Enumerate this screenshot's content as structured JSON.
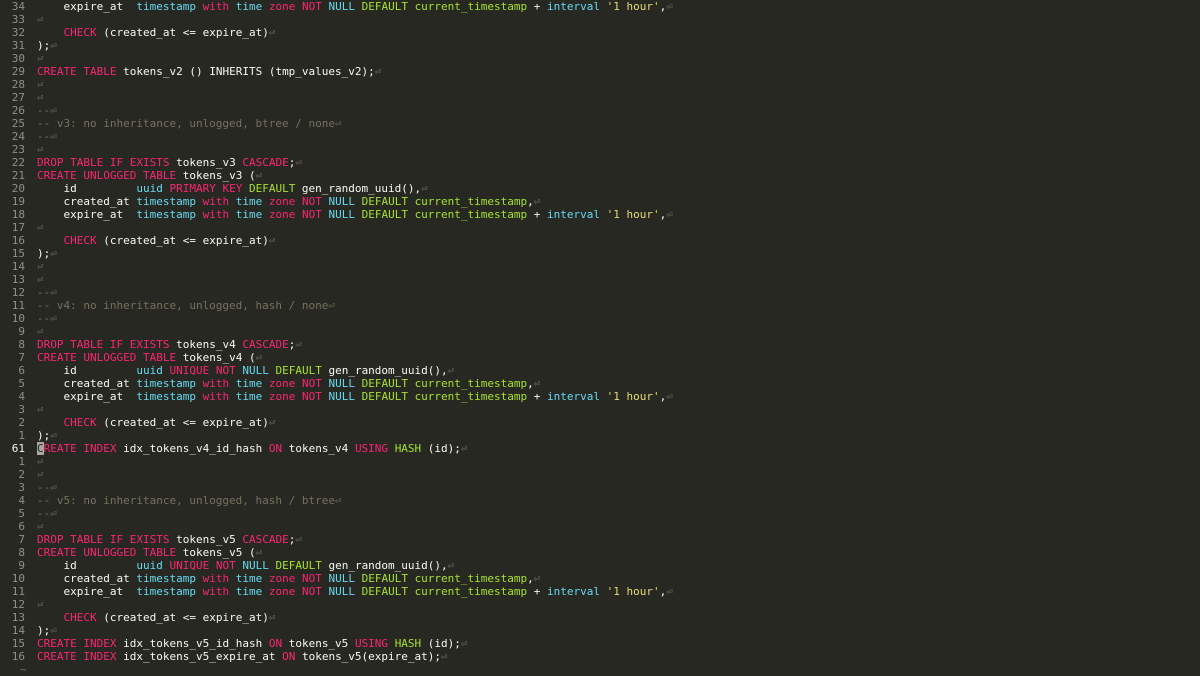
{
  "colors": {
    "background": "#272822",
    "keyword": "#f92672",
    "type": "#66d9ef",
    "string": "#e6db74",
    "comment": "#75715e",
    "function": "#a6e22e",
    "text": "#f8f8f2",
    "line_number": "#8f908a"
  },
  "eol_marker": "⏎",
  "tilde": "~",
  "lines": [
    {
      "num": "34",
      "tokens": [
        [
          "p",
          "    expire_at  "
        ],
        [
          "t",
          "timestamp"
        ],
        [
          "p",
          " "
        ],
        [
          "k",
          "with"
        ],
        [
          "p",
          " "
        ],
        [
          "t",
          "time"
        ],
        [
          "p",
          " "
        ],
        [
          "k",
          "zone"
        ],
        [
          "p",
          " "
        ],
        [
          "k",
          "NOT"
        ],
        [
          "p",
          " "
        ],
        [
          "t",
          "NULL"
        ],
        [
          "p",
          " "
        ],
        [
          "f",
          "DEFAULT"
        ],
        [
          "p",
          " "
        ],
        [
          "f",
          "current_timestamp"
        ],
        [
          "p",
          " + "
        ],
        [
          "t",
          "interval"
        ],
        [
          "p",
          " "
        ],
        [
          "s",
          "'1 hour'"
        ],
        [
          "p",
          ","
        ]
      ]
    },
    {
      "num": "33",
      "tokens": []
    },
    {
      "num": "32",
      "tokens": [
        [
          "p",
          "    "
        ],
        [
          "k",
          "CHECK"
        ],
        [
          "p",
          " (created_at <= expire_at)"
        ]
      ]
    },
    {
      "num": "31",
      "tokens": [
        [
          "p",
          ");"
        ]
      ]
    },
    {
      "num": "30",
      "tokens": []
    },
    {
      "num": "29",
      "tokens": [
        [
          "k",
          "CREATE"
        ],
        [
          "p",
          " "
        ],
        [
          "k",
          "TABLE"
        ],
        [
          "p",
          " tokens_v2 () INHERITS (tmp_values_v2);"
        ]
      ]
    },
    {
      "num": "28",
      "tokens": []
    },
    {
      "num": "27",
      "tokens": []
    },
    {
      "num": "26",
      "tokens": [
        [
          "c",
          "--"
        ]
      ]
    },
    {
      "num": "25",
      "tokens": [
        [
          "c",
          "-- v3: no inheritance, unlogged, btree / none"
        ]
      ]
    },
    {
      "num": "24",
      "tokens": [
        [
          "c",
          "--"
        ]
      ]
    },
    {
      "num": "23",
      "tokens": []
    },
    {
      "num": "22",
      "tokens": [
        [
          "k",
          "DROP"
        ],
        [
          "p",
          " "
        ],
        [
          "k",
          "TABLE"
        ],
        [
          "p",
          " "
        ],
        [
          "k",
          "IF"
        ],
        [
          "p",
          " "
        ],
        [
          "k",
          "EXISTS"
        ],
        [
          "p",
          " tokens_v3 "
        ],
        [
          "k",
          "CASCADE"
        ],
        [
          "p",
          ";"
        ]
      ]
    },
    {
      "num": "21",
      "tokens": [
        [
          "k",
          "CREATE"
        ],
        [
          "p",
          " "
        ],
        [
          "k",
          "UNLOGGED"
        ],
        [
          "p",
          " "
        ],
        [
          "k",
          "TABLE"
        ],
        [
          "p",
          " tokens_v3 ("
        ]
      ]
    },
    {
      "num": "20",
      "tokens": [
        [
          "p",
          "    id         "
        ],
        [
          "t",
          "uuid"
        ],
        [
          "p",
          " "
        ],
        [
          "k",
          "PRIMARY KEY"
        ],
        [
          "p",
          " "
        ],
        [
          "f",
          "DEFAULT"
        ],
        [
          "p",
          " gen_random_uuid(),"
        ]
      ]
    },
    {
      "num": "19",
      "tokens": [
        [
          "p",
          "    created_at "
        ],
        [
          "t",
          "timestamp"
        ],
        [
          "p",
          " "
        ],
        [
          "k",
          "with"
        ],
        [
          "p",
          " "
        ],
        [
          "t",
          "time"
        ],
        [
          "p",
          " "
        ],
        [
          "k",
          "zone"
        ],
        [
          "p",
          " "
        ],
        [
          "k",
          "NOT"
        ],
        [
          "p",
          " "
        ],
        [
          "t",
          "NULL"
        ],
        [
          "p",
          " "
        ],
        [
          "f",
          "DEFAULT"
        ],
        [
          "p",
          " "
        ],
        [
          "f",
          "current_timestamp"
        ],
        [
          "p",
          ","
        ]
      ]
    },
    {
      "num": "18",
      "tokens": [
        [
          "p",
          "    expire_at  "
        ],
        [
          "t",
          "timestamp"
        ],
        [
          "p",
          " "
        ],
        [
          "k",
          "with"
        ],
        [
          "p",
          " "
        ],
        [
          "t",
          "time"
        ],
        [
          "p",
          " "
        ],
        [
          "k",
          "zone"
        ],
        [
          "p",
          " "
        ],
        [
          "k",
          "NOT"
        ],
        [
          "p",
          " "
        ],
        [
          "t",
          "NULL"
        ],
        [
          "p",
          " "
        ],
        [
          "f",
          "DEFAULT"
        ],
        [
          "p",
          " "
        ],
        [
          "f",
          "current_timestamp"
        ],
        [
          "p",
          " + "
        ],
        [
          "t",
          "interval"
        ],
        [
          "p",
          " "
        ],
        [
          "s",
          "'1 hour'"
        ],
        [
          "p",
          ","
        ]
      ]
    },
    {
      "num": "17",
      "tokens": []
    },
    {
      "num": "16",
      "tokens": [
        [
          "p",
          "    "
        ],
        [
          "k",
          "CHECK"
        ],
        [
          "p",
          " (created_at <= expire_at)"
        ]
      ]
    },
    {
      "num": "15",
      "tokens": [
        [
          "p",
          ");"
        ]
      ]
    },
    {
      "num": "14",
      "tokens": []
    },
    {
      "num": "13",
      "tokens": []
    },
    {
      "num": "12",
      "tokens": [
        [
          "c",
          "--"
        ]
      ]
    },
    {
      "num": "11",
      "tokens": [
        [
          "c",
          "-- v4: no inheritance, unlogged, hash / none"
        ]
      ]
    },
    {
      "num": "10",
      "tokens": [
        [
          "c",
          "--"
        ]
      ]
    },
    {
      "num": "9",
      "tokens": []
    },
    {
      "num": "8",
      "tokens": [
        [
          "k",
          "DROP"
        ],
        [
          "p",
          " "
        ],
        [
          "k",
          "TABLE"
        ],
        [
          "p",
          " "
        ],
        [
          "k",
          "IF"
        ],
        [
          "p",
          " "
        ],
        [
          "k",
          "EXISTS"
        ],
        [
          "p",
          " tokens_v4 "
        ],
        [
          "k",
          "CASCADE"
        ],
        [
          "p",
          ";"
        ]
      ]
    },
    {
      "num": "7",
      "tokens": [
        [
          "k",
          "CREATE"
        ],
        [
          "p",
          " "
        ],
        [
          "k",
          "UNLOGGED"
        ],
        [
          "p",
          " "
        ],
        [
          "k",
          "TABLE"
        ],
        [
          "p",
          " tokens_v4 ("
        ]
      ]
    },
    {
      "num": "6",
      "tokens": [
        [
          "p",
          "    id         "
        ],
        [
          "t",
          "uuid"
        ],
        [
          "p",
          " "
        ],
        [
          "k",
          "UNIQUE"
        ],
        [
          "p",
          " "
        ],
        [
          "k",
          "NOT"
        ],
        [
          "p",
          " "
        ],
        [
          "t",
          "NULL"
        ],
        [
          "p",
          " "
        ],
        [
          "f",
          "DEFAULT"
        ],
        [
          "p",
          " gen_random_uuid(),"
        ]
      ]
    },
    {
      "num": "5",
      "tokens": [
        [
          "p",
          "    created_at "
        ],
        [
          "t",
          "timestamp"
        ],
        [
          "p",
          " "
        ],
        [
          "k",
          "with"
        ],
        [
          "p",
          " "
        ],
        [
          "t",
          "time"
        ],
        [
          "p",
          " "
        ],
        [
          "k",
          "zone"
        ],
        [
          "p",
          " "
        ],
        [
          "k",
          "NOT"
        ],
        [
          "p",
          " "
        ],
        [
          "t",
          "NULL"
        ],
        [
          "p",
          " "
        ],
        [
          "f",
          "DEFAULT"
        ],
        [
          "p",
          " "
        ],
        [
          "f",
          "current_timestamp"
        ],
        [
          "p",
          ","
        ]
      ]
    },
    {
      "num": "4",
      "tokens": [
        [
          "p",
          "    expire_at  "
        ],
        [
          "t",
          "timestamp"
        ],
        [
          "p",
          " "
        ],
        [
          "k",
          "with"
        ],
        [
          "p",
          " "
        ],
        [
          "t",
          "time"
        ],
        [
          "p",
          " "
        ],
        [
          "k",
          "zone"
        ],
        [
          "p",
          " "
        ],
        [
          "k",
          "NOT"
        ],
        [
          "p",
          " "
        ],
        [
          "t",
          "NULL"
        ],
        [
          "p",
          " "
        ],
        [
          "f",
          "DEFAULT"
        ],
        [
          "p",
          " "
        ],
        [
          "f",
          "current_timestamp"
        ],
        [
          "p",
          " + "
        ],
        [
          "t",
          "interval"
        ],
        [
          "p",
          " "
        ],
        [
          "s",
          "'1 hour'"
        ],
        [
          "p",
          ","
        ]
      ]
    },
    {
      "num": "3",
      "tokens": []
    },
    {
      "num": "2",
      "tokens": [
        [
          "p",
          "    "
        ],
        [
          "k",
          "CHECK"
        ],
        [
          "p",
          " (created_at <= expire_at)"
        ]
      ]
    },
    {
      "num": "1",
      "tokens": [
        [
          "p",
          ");"
        ]
      ]
    },
    {
      "num": "61",
      "current": true,
      "tokens": [
        [
          "cur",
          "C"
        ],
        [
          "k",
          "REATE"
        ],
        [
          "p",
          " "
        ],
        [
          "k",
          "INDEX"
        ],
        [
          "p",
          " idx_tokens_v4_id_hash "
        ],
        [
          "k",
          "ON"
        ],
        [
          "p",
          " tokens_v4 "
        ],
        [
          "k",
          "USING"
        ],
        [
          "p",
          " "
        ],
        [
          "f",
          "HASH"
        ],
        [
          "p",
          " (id);"
        ]
      ]
    },
    {
      "num": "1",
      "tokens": []
    },
    {
      "num": "2",
      "tokens": []
    },
    {
      "num": "3",
      "tokens": [
        [
          "c",
          "--"
        ]
      ]
    },
    {
      "num": "4",
      "tokens": [
        [
          "c",
          "-- v5: no inheritance, unlogged, hash / btree"
        ]
      ]
    },
    {
      "num": "5",
      "tokens": [
        [
          "c",
          "--"
        ]
      ]
    },
    {
      "num": "6",
      "tokens": []
    },
    {
      "num": "7",
      "tokens": [
        [
          "k",
          "DROP"
        ],
        [
          "p",
          " "
        ],
        [
          "k",
          "TABLE"
        ],
        [
          "p",
          " "
        ],
        [
          "k",
          "IF"
        ],
        [
          "p",
          " "
        ],
        [
          "k",
          "EXISTS"
        ],
        [
          "p",
          " tokens_v5 "
        ],
        [
          "k",
          "CASCADE"
        ],
        [
          "p",
          ";"
        ]
      ]
    },
    {
      "num": "8",
      "tokens": [
        [
          "k",
          "CREATE"
        ],
        [
          "p",
          " "
        ],
        [
          "k",
          "UNLOGGED"
        ],
        [
          "p",
          " "
        ],
        [
          "k",
          "TABLE"
        ],
        [
          "p",
          " tokens_v5 ("
        ]
      ]
    },
    {
      "num": "9",
      "tokens": [
        [
          "p",
          "    id         "
        ],
        [
          "t",
          "uuid"
        ],
        [
          "p",
          " "
        ],
        [
          "k",
          "UNIQUE"
        ],
        [
          "p",
          " "
        ],
        [
          "k",
          "NOT"
        ],
        [
          "p",
          " "
        ],
        [
          "t",
          "NULL"
        ],
        [
          "p",
          " "
        ],
        [
          "f",
          "DEFAULT"
        ],
        [
          "p",
          " gen_random_uuid(),"
        ]
      ]
    },
    {
      "num": "10",
      "tokens": [
        [
          "p",
          "    created_at "
        ],
        [
          "t",
          "timestamp"
        ],
        [
          "p",
          " "
        ],
        [
          "k",
          "with"
        ],
        [
          "p",
          " "
        ],
        [
          "t",
          "time"
        ],
        [
          "p",
          " "
        ],
        [
          "k",
          "zone"
        ],
        [
          "p",
          " "
        ],
        [
          "k",
          "NOT"
        ],
        [
          "p",
          " "
        ],
        [
          "t",
          "NULL"
        ],
        [
          "p",
          " "
        ],
        [
          "f",
          "DEFAULT"
        ],
        [
          "p",
          " "
        ],
        [
          "f",
          "current_timestamp"
        ],
        [
          "p",
          ","
        ]
      ]
    },
    {
      "num": "11",
      "tokens": [
        [
          "p",
          "    expire_at  "
        ],
        [
          "t",
          "timestamp"
        ],
        [
          "p",
          " "
        ],
        [
          "k",
          "with"
        ],
        [
          "p",
          " "
        ],
        [
          "t",
          "time"
        ],
        [
          "p",
          " "
        ],
        [
          "k",
          "zone"
        ],
        [
          "p",
          " "
        ],
        [
          "k",
          "NOT"
        ],
        [
          "p",
          " "
        ],
        [
          "t",
          "NULL"
        ],
        [
          "p",
          " "
        ],
        [
          "f",
          "DEFAULT"
        ],
        [
          "p",
          " "
        ],
        [
          "f",
          "current_timestamp"
        ],
        [
          "p",
          " + "
        ],
        [
          "t",
          "interval"
        ],
        [
          "p",
          " "
        ],
        [
          "s",
          "'1 hour'"
        ],
        [
          "p",
          ","
        ]
      ]
    },
    {
      "num": "12",
      "tokens": []
    },
    {
      "num": "13",
      "tokens": [
        [
          "p",
          "    "
        ],
        [
          "k",
          "CHECK"
        ],
        [
          "p",
          " (created_at <= expire_at)"
        ]
      ]
    },
    {
      "num": "14",
      "tokens": [
        [
          "p",
          ");"
        ]
      ]
    },
    {
      "num": "15",
      "tokens": [
        [
          "k",
          "CREATE"
        ],
        [
          "p",
          " "
        ],
        [
          "k",
          "INDEX"
        ],
        [
          "p",
          " idx_tokens_v5_id_hash "
        ],
        [
          "k",
          "ON"
        ],
        [
          "p",
          " tokens_v5 "
        ],
        [
          "k",
          "USING"
        ],
        [
          "p",
          " "
        ],
        [
          "f",
          "HASH"
        ],
        [
          "p",
          " (id);"
        ]
      ]
    },
    {
      "num": "16",
      "tokens": [
        [
          "k",
          "CREATE"
        ],
        [
          "p",
          " "
        ],
        [
          "k",
          "INDEX"
        ],
        [
          "p",
          " idx_tokens_v5_expire_at "
        ],
        [
          "k",
          "ON"
        ],
        [
          "p",
          " tokens_v5(expire_at);"
        ]
      ]
    }
  ]
}
